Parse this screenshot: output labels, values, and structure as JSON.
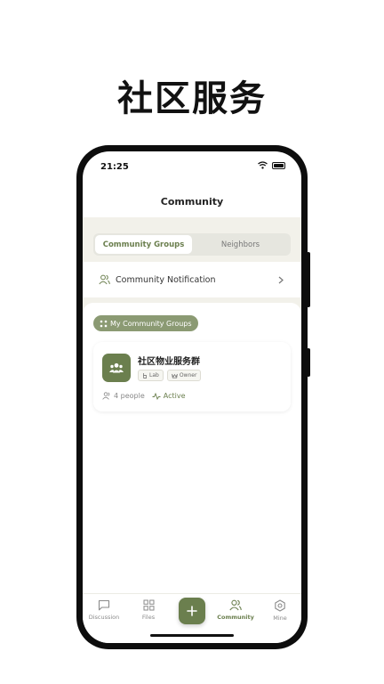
{
  "hero_title": "社区服务",
  "status": {
    "time": "21:25"
  },
  "nav": {
    "title": "Community"
  },
  "segmented": {
    "tabs": [
      "Community Groups",
      "Neighbors"
    ],
    "active_index": 0
  },
  "notification_row": {
    "label": "Community Notification",
    "icon": "users-icon"
  },
  "section_chip": {
    "label": "My Community Groups",
    "icon": "grid-icon"
  },
  "group": {
    "name": "社区物业服务群",
    "tags": [
      {
        "label": "Lab",
        "icon": "hand-icon"
      },
      {
        "label": "Owner",
        "icon": "crown-icon"
      }
    ],
    "members": "4 people",
    "status": "Active"
  },
  "tabbar": {
    "items": [
      {
        "label": "Discussion",
        "icon": "chat-icon"
      },
      {
        "label": "Files",
        "icon": "grid-icon"
      },
      {
        "label": "",
        "icon": "plus-icon"
      },
      {
        "label": "Community",
        "icon": "users-icon"
      },
      {
        "label": "Mine",
        "icon": "gear-icon"
      }
    ],
    "active_index": 3
  },
  "colors": {
    "accent": "#6b7f4e",
    "chip": "#8b9a73",
    "background": "#f2f1ea"
  }
}
